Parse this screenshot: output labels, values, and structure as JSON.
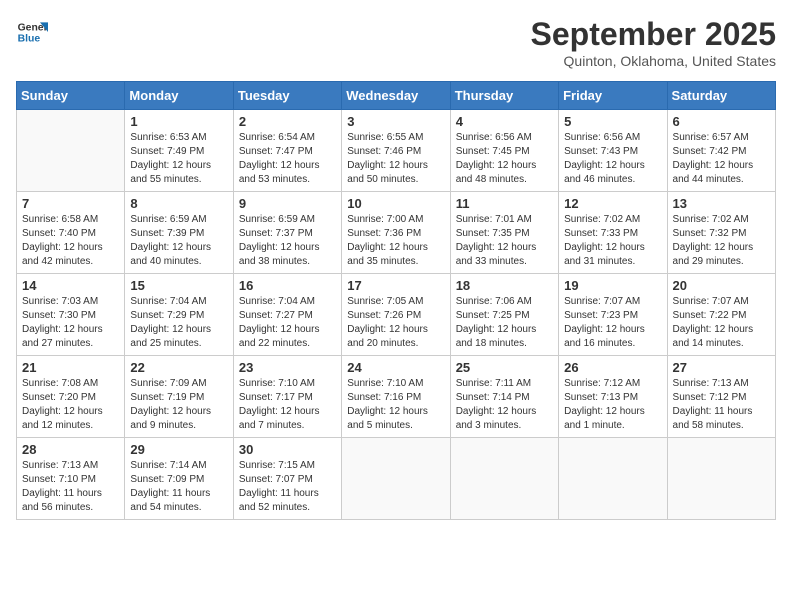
{
  "logo": {
    "line1": "General",
    "line2": "Blue"
  },
  "title": "September 2025",
  "location": "Quinton, Oklahoma, United States",
  "days_of_week": [
    "Sunday",
    "Monday",
    "Tuesday",
    "Wednesday",
    "Thursday",
    "Friday",
    "Saturday"
  ],
  "weeks": [
    [
      {
        "day": "",
        "info": ""
      },
      {
        "day": "1",
        "info": "Sunrise: 6:53 AM\nSunset: 7:49 PM\nDaylight: 12 hours\nand 55 minutes."
      },
      {
        "day": "2",
        "info": "Sunrise: 6:54 AM\nSunset: 7:47 PM\nDaylight: 12 hours\nand 53 minutes."
      },
      {
        "day": "3",
        "info": "Sunrise: 6:55 AM\nSunset: 7:46 PM\nDaylight: 12 hours\nand 50 minutes."
      },
      {
        "day": "4",
        "info": "Sunrise: 6:56 AM\nSunset: 7:45 PM\nDaylight: 12 hours\nand 48 minutes."
      },
      {
        "day": "5",
        "info": "Sunrise: 6:56 AM\nSunset: 7:43 PM\nDaylight: 12 hours\nand 46 minutes."
      },
      {
        "day": "6",
        "info": "Sunrise: 6:57 AM\nSunset: 7:42 PM\nDaylight: 12 hours\nand 44 minutes."
      }
    ],
    [
      {
        "day": "7",
        "info": "Sunrise: 6:58 AM\nSunset: 7:40 PM\nDaylight: 12 hours\nand 42 minutes."
      },
      {
        "day": "8",
        "info": "Sunrise: 6:59 AM\nSunset: 7:39 PM\nDaylight: 12 hours\nand 40 minutes."
      },
      {
        "day": "9",
        "info": "Sunrise: 6:59 AM\nSunset: 7:37 PM\nDaylight: 12 hours\nand 38 minutes."
      },
      {
        "day": "10",
        "info": "Sunrise: 7:00 AM\nSunset: 7:36 PM\nDaylight: 12 hours\nand 35 minutes."
      },
      {
        "day": "11",
        "info": "Sunrise: 7:01 AM\nSunset: 7:35 PM\nDaylight: 12 hours\nand 33 minutes."
      },
      {
        "day": "12",
        "info": "Sunrise: 7:02 AM\nSunset: 7:33 PM\nDaylight: 12 hours\nand 31 minutes."
      },
      {
        "day": "13",
        "info": "Sunrise: 7:02 AM\nSunset: 7:32 PM\nDaylight: 12 hours\nand 29 minutes."
      }
    ],
    [
      {
        "day": "14",
        "info": "Sunrise: 7:03 AM\nSunset: 7:30 PM\nDaylight: 12 hours\nand 27 minutes."
      },
      {
        "day": "15",
        "info": "Sunrise: 7:04 AM\nSunset: 7:29 PM\nDaylight: 12 hours\nand 25 minutes."
      },
      {
        "day": "16",
        "info": "Sunrise: 7:04 AM\nSunset: 7:27 PM\nDaylight: 12 hours\nand 22 minutes."
      },
      {
        "day": "17",
        "info": "Sunrise: 7:05 AM\nSunset: 7:26 PM\nDaylight: 12 hours\nand 20 minutes."
      },
      {
        "day": "18",
        "info": "Sunrise: 7:06 AM\nSunset: 7:25 PM\nDaylight: 12 hours\nand 18 minutes."
      },
      {
        "day": "19",
        "info": "Sunrise: 7:07 AM\nSunset: 7:23 PM\nDaylight: 12 hours\nand 16 minutes."
      },
      {
        "day": "20",
        "info": "Sunrise: 7:07 AM\nSunset: 7:22 PM\nDaylight: 12 hours\nand 14 minutes."
      }
    ],
    [
      {
        "day": "21",
        "info": "Sunrise: 7:08 AM\nSunset: 7:20 PM\nDaylight: 12 hours\nand 12 minutes."
      },
      {
        "day": "22",
        "info": "Sunrise: 7:09 AM\nSunset: 7:19 PM\nDaylight: 12 hours\nand 9 minutes."
      },
      {
        "day": "23",
        "info": "Sunrise: 7:10 AM\nSunset: 7:17 PM\nDaylight: 12 hours\nand 7 minutes."
      },
      {
        "day": "24",
        "info": "Sunrise: 7:10 AM\nSunset: 7:16 PM\nDaylight: 12 hours\nand 5 minutes."
      },
      {
        "day": "25",
        "info": "Sunrise: 7:11 AM\nSunset: 7:14 PM\nDaylight: 12 hours\nand 3 minutes."
      },
      {
        "day": "26",
        "info": "Sunrise: 7:12 AM\nSunset: 7:13 PM\nDaylight: 12 hours\nand 1 minute."
      },
      {
        "day": "27",
        "info": "Sunrise: 7:13 AM\nSunset: 7:12 PM\nDaylight: 11 hours\nand 58 minutes."
      }
    ],
    [
      {
        "day": "28",
        "info": "Sunrise: 7:13 AM\nSunset: 7:10 PM\nDaylight: 11 hours\nand 56 minutes."
      },
      {
        "day": "29",
        "info": "Sunrise: 7:14 AM\nSunset: 7:09 PM\nDaylight: 11 hours\nand 54 minutes."
      },
      {
        "day": "30",
        "info": "Sunrise: 7:15 AM\nSunset: 7:07 PM\nDaylight: 11 hours\nand 52 minutes."
      },
      {
        "day": "",
        "info": ""
      },
      {
        "day": "",
        "info": ""
      },
      {
        "day": "",
        "info": ""
      },
      {
        "day": "",
        "info": ""
      }
    ]
  ]
}
